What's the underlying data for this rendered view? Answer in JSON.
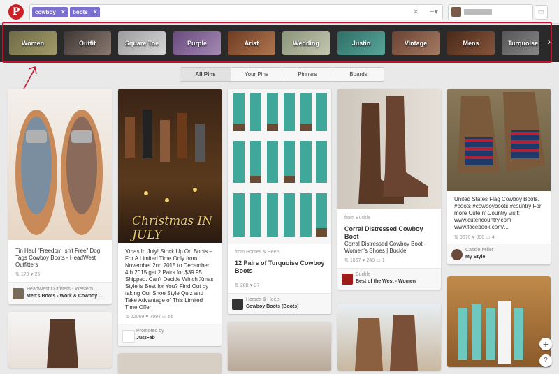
{
  "search": {
    "tokens": [
      "cowboy",
      "boots"
    ],
    "token_close": "×",
    "clear": "×",
    "menu": "≡▾"
  },
  "logo": "P",
  "guided": {
    "tiles": [
      "Women",
      "Outfit",
      "Square Toe",
      "Purple",
      "Ariat",
      "Wedding",
      "Justin",
      "Vintage",
      "Mens",
      "Turquoise"
    ],
    "next": "›"
  },
  "tabs": [
    "All Pins",
    "Your Pins",
    "Pinners",
    "Boards"
  ],
  "pins": {
    "p1": {
      "desc": "Tin Haul \"Freedom isn't Free\" Dog Tags Cowboy Boots - HeadWest Outfitters",
      "repins": "179",
      "likes": "25",
      "attr1": "HeadWest Outfitters - Western ...",
      "attr2": "Men's Boots - Work & Cowboy ..."
    },
    "p2": {
      "overlay": "Christmas IN JULY",
      "desc": "Xmas In July! Stock Up On Boots – For A Limited Time Only from November 2nd 2015 to December 4th 2015 get 2 Pairs for $39.95 Shipped. Can't Decide Which Xmas Style is Best for You? Find Out by taking Our Shoe Style Quiz and Take Advantage of This Limited Time Offer!",
      "repins": "22069",
      "likes": "7994",
      "comments": "56",
      "attr1": "Promoted by",
      "attr2": "JustFab"
    },
    "p3": {
      "from": "from Horses & Heels",
      "title": "12 Pairs of Turquoise Cowboy Boots",
      "repins": "288",
      "likes": "37",
      "attr1": "Horses & Heels",
      "attr2": "Cowboy Boots (Boots)"
    },
    "p4": {
      "from": "from Buckle",
      "title": "Corral Distressed Cowboy Boot",
      "desc": "Corral Distressed Cowboy Boot - Women's Shoes | Buckle",
      "repins": "1667",
      "likes": "240",
      "comments": "1",
      "attr1": "Buckle",
      "attr2": "Best of the West - Women"
    },
    "p5": {
      "desc": "United States Flag Cowboy Boots. #boots #cowboyboots #country For more Cute n' Country visit: www.cutencountry.com www.facebook.com/...",
      "repins": "3670",
      "likes": "898",
      "comments": "4",
      "attr1": "Cassie Miller",
      "attr2": "My Style"
    }
  },
  "icons": {
    "add": "+",
    "help": "?",
    "repin": "⇅",
    "like": "♥",
    "comment": "▭"
  },
  "colors": {
    "brand_red": "#cb2027",
    "token": "#7b6fd1",
    "annotation": "#c8102e"
  }
}
